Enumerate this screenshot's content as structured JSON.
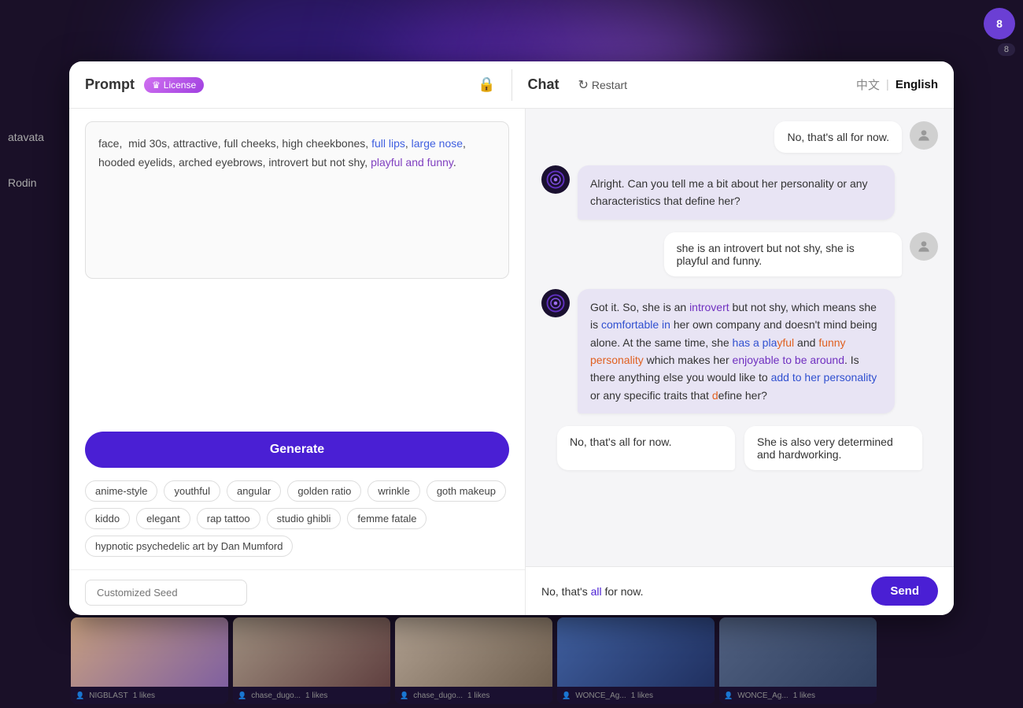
{
  "background": {
    "blobs": [
      "blob1",
      "blob2",
      "blob3"
    ]
  },
  "topRight": {
    "avatarLabel": "8",
    "badgeLabel": "8"
  },
  "header": {
    "promptLabel": "Prompt",
    "licenseLabel": "License",
    "lockIcon": "🔒",
    "chatLabel": "Chat",
    "restartLabel": "Restart",
    "zhLabel": "中文",
    "dividerLabel": "|",
    "enLabel": "English"
  },
  "prompt": {
    "text": "face,  mid 30s, attractive, full cheeks, high cheekbones, full lips, large nose, hooded eyelids, arched eyebrows, introvert but not shy, playful and funny.",
    "generateLabel": "Generate",
    "tags": [
      "anime-style",
      "youthful",
      "angular",
      "golden ratio",
      "wrinkle",
      "goth makeup",
      "kiddo",
      "elegant",
      "rap tattoo",
      "studio ghibli",
      "femme fatale",
      "hypnotic psychedelic art by Dan Mumford"
    ],
    "seedPlaceholder": "Customized Seed"
  },
  "chat": {
    "restartLabel": "Restart",
    "messages": [
      {
        "type": "user",
        "text": "No, that's all for now."
      },
      {
        "type": "ai",
        "text": "Alright. Can you tell me a bit about her personality or any characteristics that define her?"
      },
      {
        "type": "user",
        "text": "she is an introvert but not shy, she is playful and funny."
      },
      {
        "type": "ai",
        "text": "Got it. So, she is an introvert but not shy, which means she is comfortable in her own company and doesn't mind being alone. At the same time, she has a playful and funny personality which makes her enjoyable to be around. Is there anything else you would like to add to her personality or any specific traits that define her?"
      }
    ],
    "suggestedReplies": [
      "No, that's all for now.",
      "She is also very determined and hardworking."
    ],
    "inputValue": "No, that's all for now.",
    "sendLabel": "Send"
  },
  "gallery": {
    "items": [
      {
        "user": "NIGBLAST",
        "likes": "1 likes"
      },
      {
        "user": "chase_dugo...",
        "likes": "1 likes"
      },
      {
        "user": "chase_dugo...",
        "likes": "1 likes"
      },
      {
        "user": "WONCE_Ag...",
        "likes": "1 likes"
      },
      {
        "user": "WONCE_Ag...",
        "likes": "1 likes"
      }
    ]
  }
}
